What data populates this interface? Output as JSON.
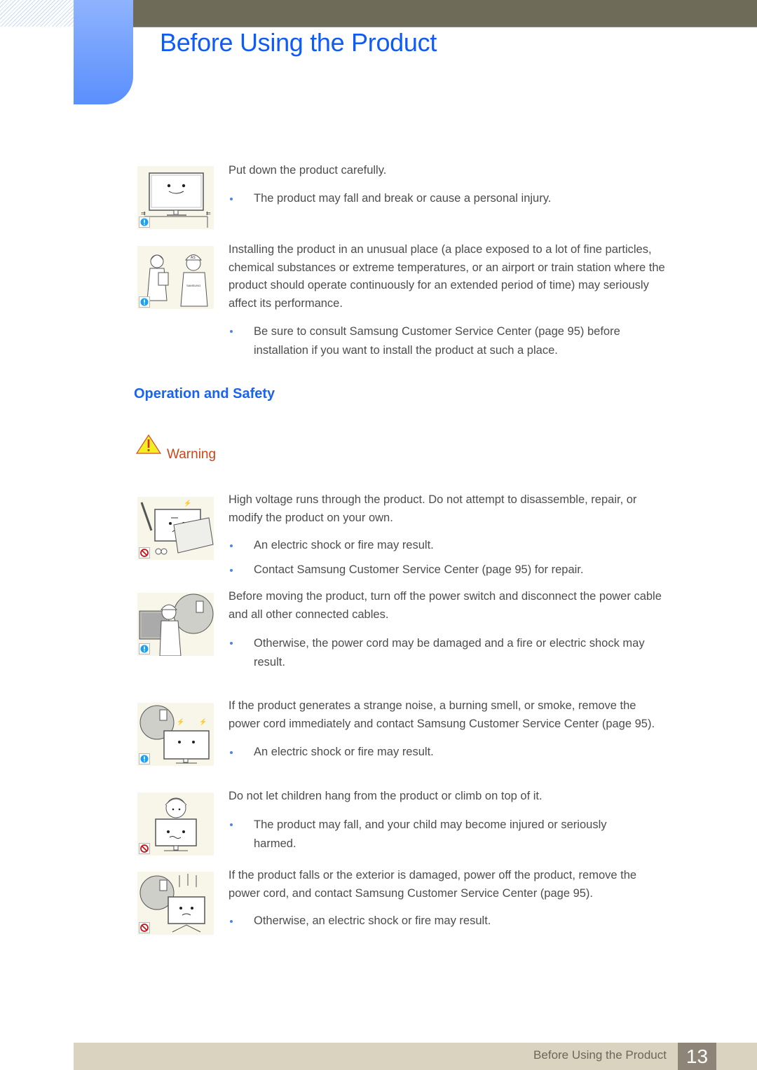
{
  "header": {
    "title": "Before Using the Product"
  },
  "intro_items": [
    {
      "icon": "caution-icon",
      "illustration": "monitor-on-stand-illustration",
      "paragraph": "Put down the product carefully.",
      "bullets": [
        "The product may fall and break or cause a personal injury."
      ]
    },
    {
      "icon": "caution-icon",
      "illustration": "customer-service-illustration",
      "paragraph": "Installing the product in an unusual place (a place exposed to a lot of fine particles, chemical substances or extreme temperatures, or an airport or train station where the product should operate continuously for an extended period of time) may seriously affect its performance.",
      "bullets": [
        "Be sure to consult Samsung Customer Service Center (page 95) before installation if you want to install the product at such a place."
      ]
    }
  ],
  "section": {
    "title": "Operation and Safety",
    "warning_label": "Warning"
  },
  "safety_items": [
    {
      "icon": "prohibited-icon",
      "illustration": "disassembly-illustration",
      "paragraph": "High voltage runs through the product. Do not attempt to disassemble, repair, or modify the product on your own.",
      "bullets": [
        "An electric shock or fire may result.",
        "Contact Samsung Customer Service Center (page 95) for repair."
      ]
    },
    {
      "icon": "caution-icon",
      "illustration": "unplug-before-moving-illustration",
      "paragraph": "Before moving the product, turn off the power switch and disconnect the power cable and all other connected cables.",
      "bullets": [
        "Otherwise, the power cord may be damaged and a fire or electric shock may result."
      ]
    },
    {
      "icon": "caution-icon",
      "illustration": "smoke-unplug-illustration",
      "paragraph": "If the product generates a strange noise, a burning smell, or smoke, remove the power cord immediately and contact Samsung Customer Service Center (page 95).",
      "bullets": [
        "An electric shock or fire may result."
      ]
    },
    {
      "icon": "prohibited-icon",
      "illustration": "child-climbing-illustration",
      "paragraph": "Do not let children hang from the product or climb on top of it.",
      "bullets": [
        "The product may fall, and your child may become injured or seriously harmed."
      ]
    },
    {
      "icon": "prohibited-icon",
      "illustration": "fallen-product-illustration",
      "paragraph": "If the product falls or the exterior is damaged, power off the product, remove the power cord, and contact Samsung Customer Service Center (page 95).",
      "bullets": [
        "Otherwise, an electric shock or fire may result."
      ]
    }
  ],
  "footer": {
    "title": "Before Using the Product",
    "page_number": "13"
  },
  "colors": {
    "title_blue": "#0f5bf5",
    "section_blue": "#1a63f2",
    "warning_orange": "#c8461a",
    "bullet_blue": "#4a86e8",
    "top_bar": "#6e6c58",
    "footer_bar": "#d9d3c0",
    "page_number_bg": "#8e8578"
  }
}
